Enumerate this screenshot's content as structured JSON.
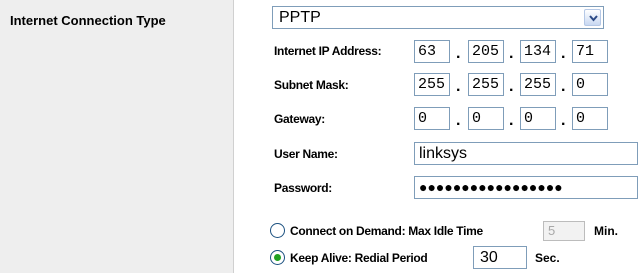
{
  "section": {
    "title": "Internet Connection Type"
  },
  "connection_type": {
    "selected": "PPTP"
  },
  "fields": {
    "ip_label": "Internet IP Address:",
    "ip": [
      "63",
      "205",
      "134",
      "71"
    ],
    "subnet_label": "Subnet Mask:",
    "subnet": [
      "255",
      "255",
      "255",
      "0"
    ],
    "gateway_label": "Gateway:",
    "gateway": [
      "0",
      "0",
      "0",
      "0"
    ],
    "username_label": "User Name:",
    "username": "linksys",
    "password_label": "Password:",
    "password_mask": "●●●●●●●●●●●●●●●●●"
  },
  "connect_on_demand": {
    "label": "Connect on Demand: Max Idle Time",
    "value": "5",
    "unit": "Min.",
    "selected": false
  },
  "keep_alive": {
    "label": "Keep Alive: Redial Period",
    "value": "30",
    "unit": "Sec.",
    "selected": true
  },
  "colors": {
    "radio_selected": "#21a121",
    "input_border": "#7f9db9",
    "panel_bg": "#eeeeee"
  }
}
